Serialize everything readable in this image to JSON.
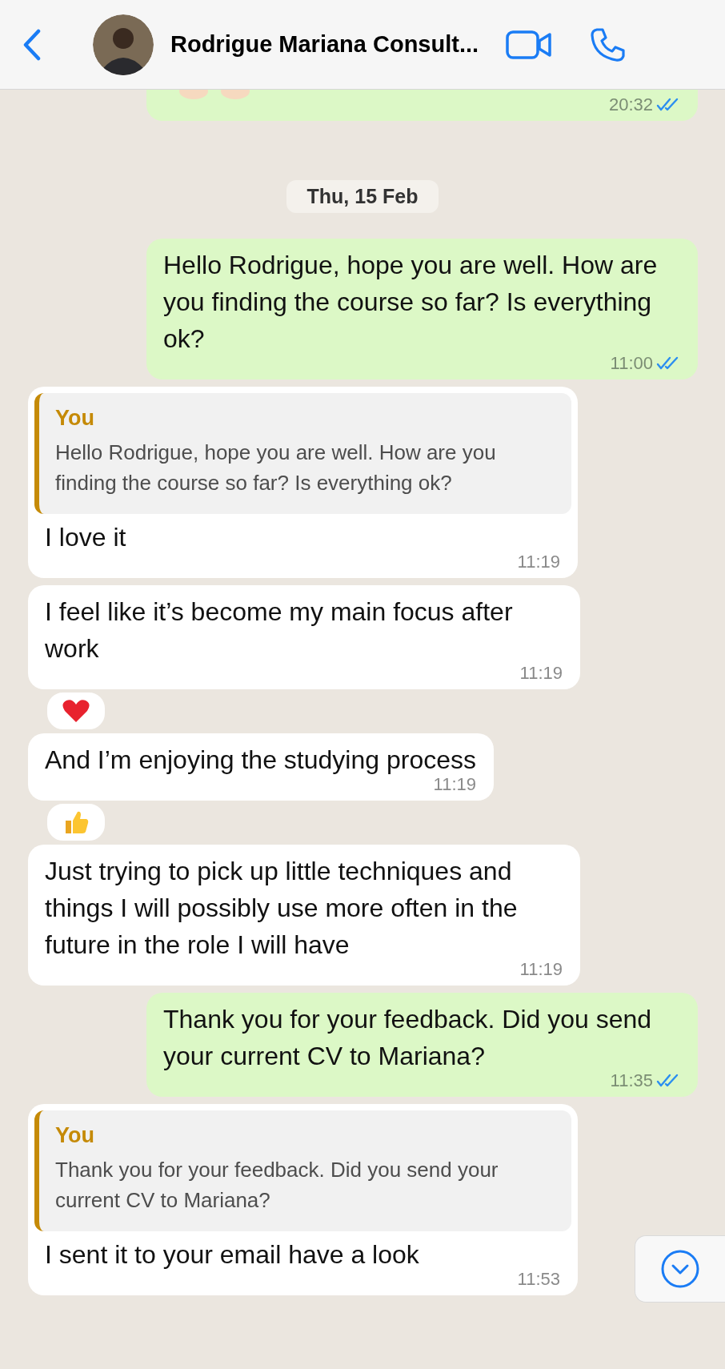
{
  "header": {
    "contact_name": "Rodrigue Mariana Consult..."
  },
  "messages": [
    {
      "kind": "outgoing",
      "partial": true,
      "time": "20:32",
      "read": true
    },
    {
      "kind": "date",
      "text": "Thu, 15 Feb"
    },
    {
      "kind": "outgoing",
      "text": "Hello Rodrigue, hope you are well. How are you finding the course so far? Is everything ok?",
      "time": "11:00",
      "read": true
    },
    {
      "kind": "incoming",
      "reply": {
        "author": "You",
        "text": "Hello Rodrigue, hope you are well. How are you finding the course so far? Is everything ok?"
      },
      "text": "I love it",
      "time": "11:19"
    },
    {
      "kind": "incoming",
      "text": "I feel like it’s become my main focus after work",
      "time": "11:19",
      "reaction": {
        "kind": "heart"
      }
    },
    {
      "kind": "incoming",
      "text": "And I’m enjoying the studying process",
      "time": "11:19",
      "reaction": {
        "kind": "thumbs_up"
      }
    },
    {
      "kind": "incoming",
      "text": "Just trying to pick up little techniques and things I will possibly use more often in the future in the role I will have",
      "time": "11:19"
    },
    {
      "kind": "outgoing",
      "text": "Thank you for your feedback. Did you send your current  CV to Mariana?",
      "time": "11:35",
      "read": true
    },
    {
      "kind": "incoming",
      "reply": {
        "author": "You",
        "text": "Thank you for your feedback. Did you send your current  CV to Mariana?"
      },
      "text": "I sent it to your email have a look",
      "time": "11:53"
    }
  ]
}
